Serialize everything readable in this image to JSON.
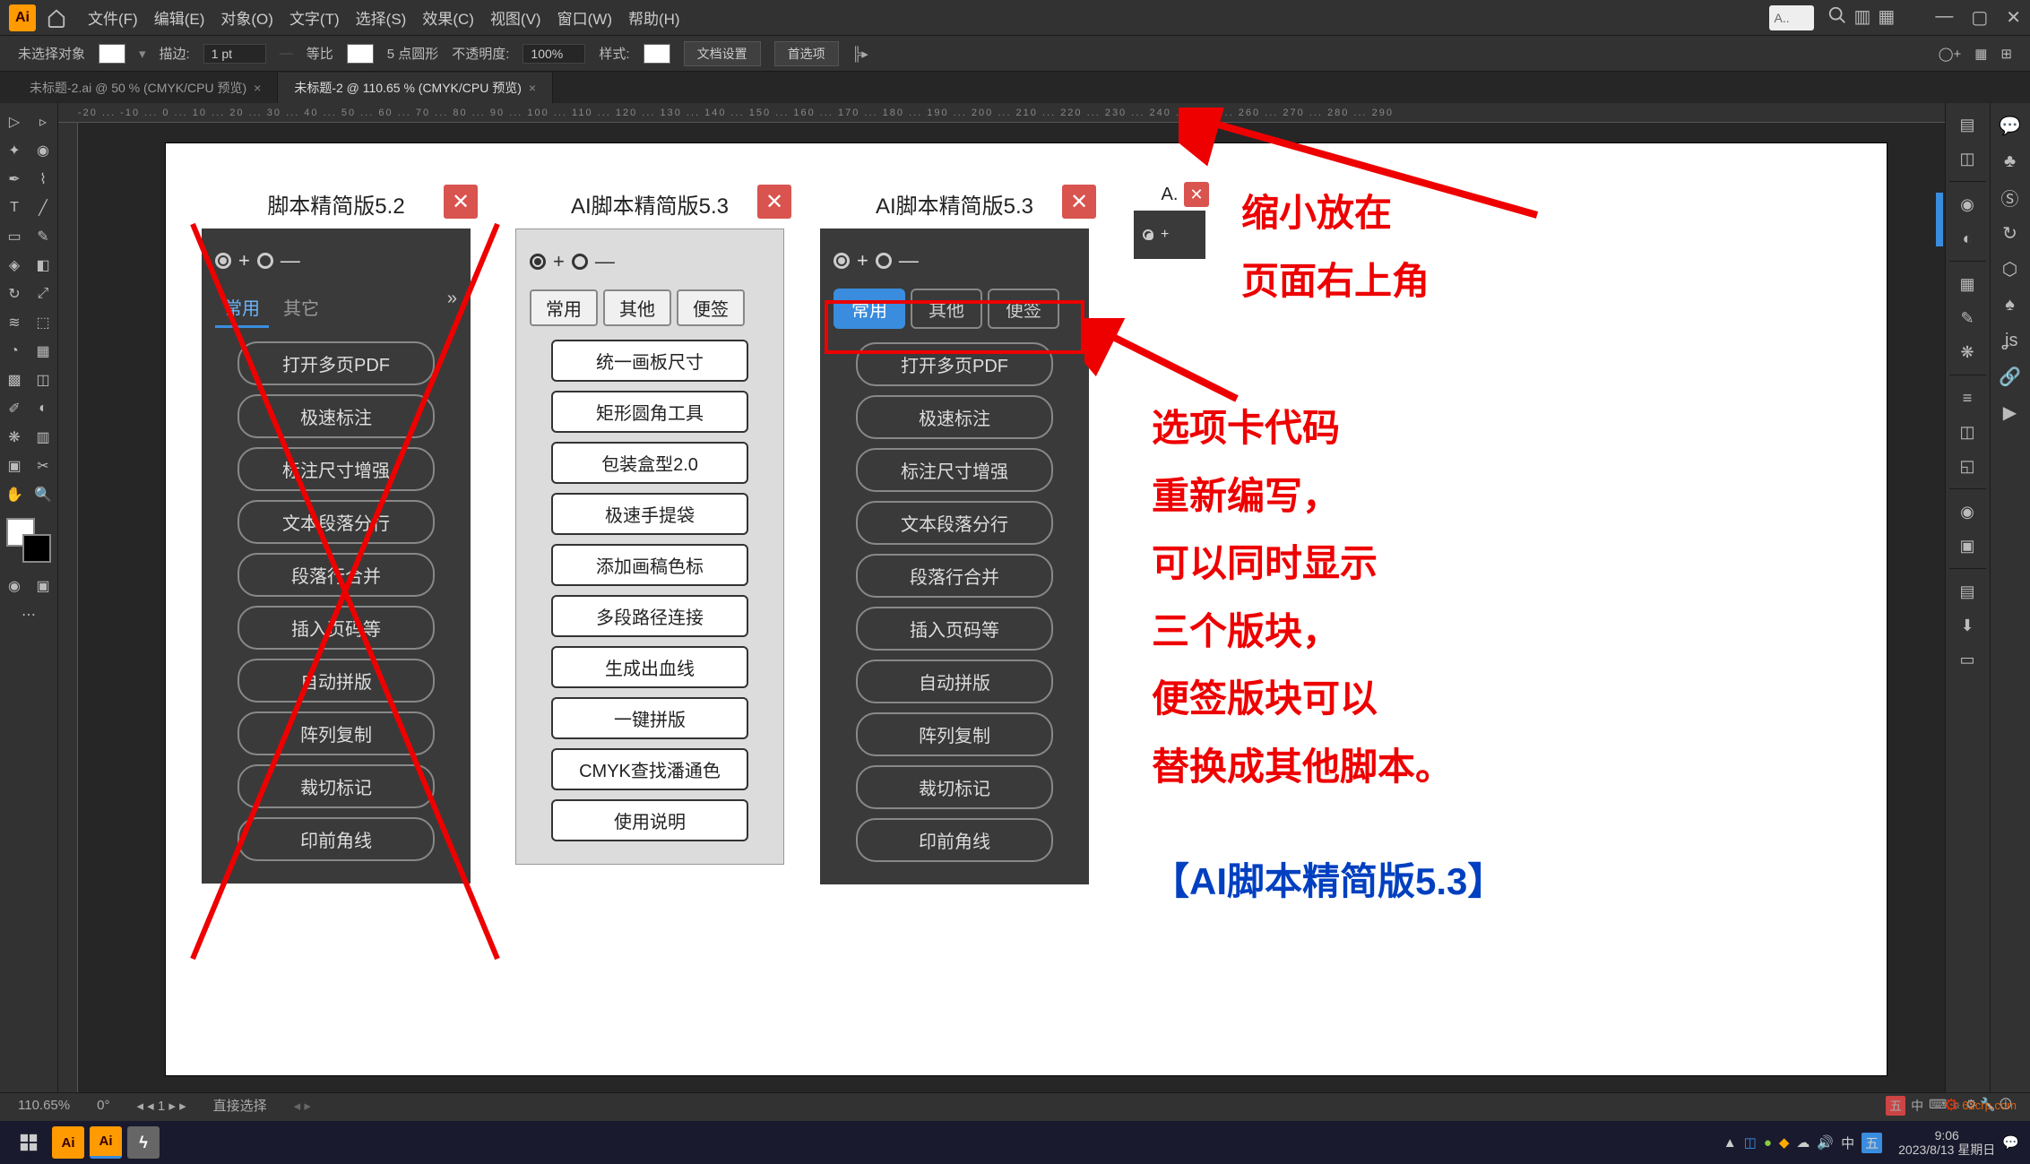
{
  "app": {
    "logo": "Ai"
  },
  "menu": {
    "items": [
      "文件(F)",
      "编辑(E)",
      "对象(O)",
      "文字(T)",
      "选择(S)",
      "效果(C)",
      "视图(V)",
      "窗口(W)",
      "帮助(H)"
    ]
  },
  "top_search": {
    "placeholder": "A.."
  },
  "options": {
    "no_selection": "未选择对象",
    "stroke_label": "描边:",
    "stroke_value": "1 pt",
    "uniform": "等比",
    "brush_preset": "5 点圆形",
    "opacity_label": "不透明度:",
    "opacity_value": "100%",
    "style_label": "样式:",
    "doc_setup": "文档设置",
    "prefs": "首选项"
  },
  "tabs": [
    {
      "label": "未标题-2.ai @ 50 % (CMYK/CPU 预览)",
      "active": false
    },
    {
      "label": "未标题-2 @ 110.65 % (CMYK/CPU 预览)",
      "active": true
    }
  ],
  "ruler_marks": "-20 ... -10 ... 0 ... 10 ... 20 ... 30 ... 40 ... 50 ... 60 ... 70 ... 80 ... 90 ... 100 ... 110 ... 120 ... 130 ... 140 ... 150 ... 160 ... 170 ... 180 ... 190 ... 200 ... 210 ... 220 ... 230 ... 240 ... 250 ... 260 ... 270 ... 280 ... 290",
  "panel52": {
    "title": "脚本精简版5.2",
    "tabs": [
      "常用",
      "其它"
    ],
    "buttons": [
      "打开多页PDF",
      "极速标注",
      "标注尺寸增强",
      "文本段落分行",
      "段落行合并",
      "插入页码等",
      "自动拼版",
      "阵列复制",
      "裁切标记",
      "印前角线"
    ]
  },
  "panel53_light": {
    "title": "AI脚本精简版5.3",
    "tabs": [
      "常用",
      "其他",
      "便签"
    ],
    "buttons": [
      "统一画板尺寸",
      "矩形圆角工具",
      "包装盒型2.0",
      "极速手提袋",
      "添加画稿色标",
      "多段路径连接",
      "生成出血线",
      "一键拼版",
      "CMYK查找潘通色",
      "使用说明"
    ]
  },
  "panel53_dark": {
    "title": "AI脚本精简版5.3",
    "tabs": [
      "常用",
      "其他",
      "便签"
    ],
    "buttons": [
      "打开多页PDF",
      "极速标注",
      "标注尺寸增强",
      "文本段落分行",
      "段落行合并",
      "插入页码等",
      "自动拼版",
      "阵列复制",
      "裁切标记",
      "印前角线"
    ]
  },
  "panel_mini": {
    "title": "A."
  },
  "annotations": {
    "top": "缩小放在\n页面右上角",
    "mid": "选项卡代码\n重新编写，\n可以同时显示\n三个版块，\n便签版块可以\n替换成其他脚本。",
    "bottom": "【AI脚本精简版5.3】"
  },
  "status": {
    "zoom": "110.65%",
    "angle": "0°",
    "artboard": "1",
    "mode": "直接选择"
  },
  "tray": {
    "ime": "五",
    "ime2": "中",
    "time": "9:06",
    "date": "2023/8/13 星期日"
  },
  "watermark": "62crp.com"
}
